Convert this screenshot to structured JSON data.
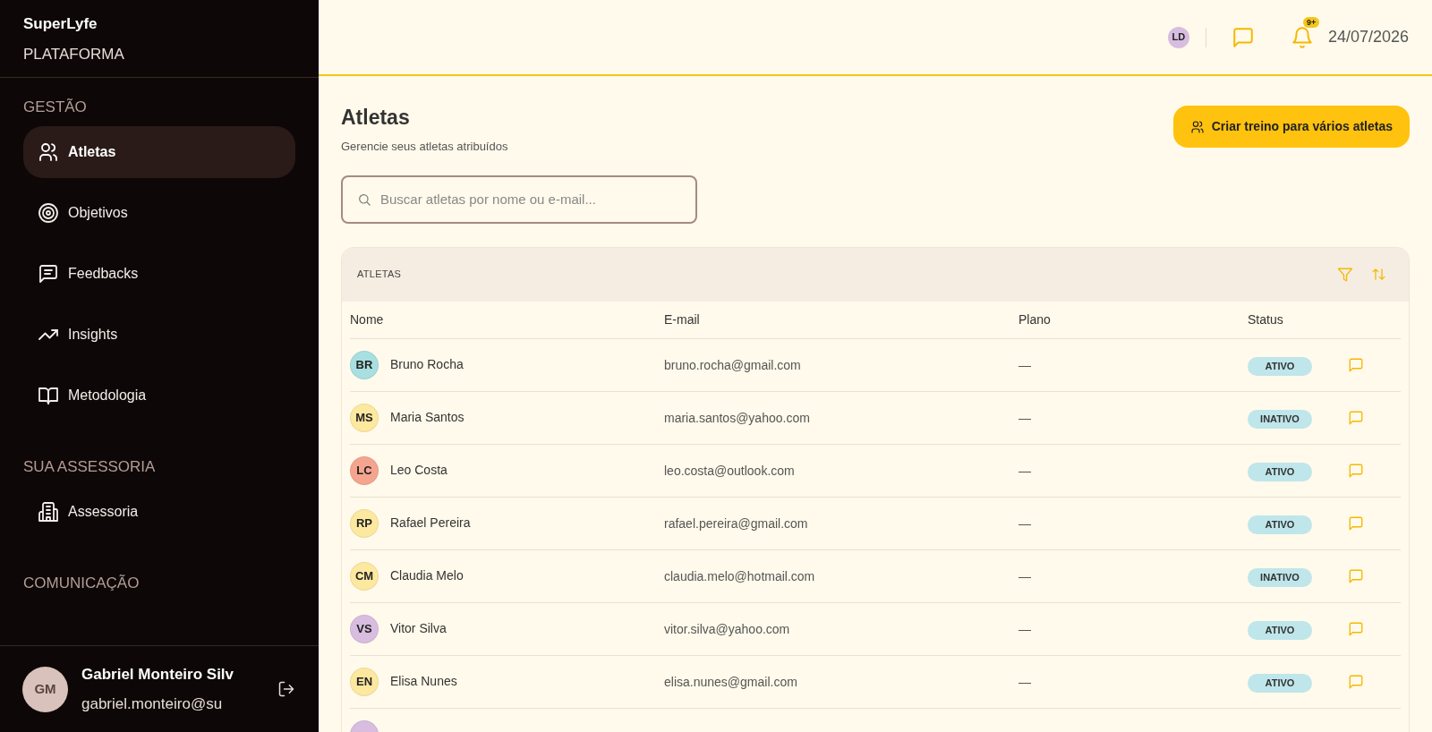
{
  "sidebar": {
    "brand": "SuperLyfe",
    "subtitle": "PLATAFORMA",
    "sections": [
      {
        "title": "GESTÃO",
        "items": [
          {
            "label": "Atletas",
            "kind": "users",
            "selected": true
          },
          {
            "label": "Objetivos",
            "kind": "target",
            "selected": false
          },
          {
            "label": "Feedbacks",
            "kind": "feedback",
            "selected": false
          },
          {
            "label": "Insights",
            "kind": "trend",
            "selected": false
          },
          {
            "label": "Metodologia",
            "kind": "book",
            "selected": false
          }
        ]
      },
      {
        "title": "SUA ASSESSORIA",
        "items": [
          {
            "label": "Assessoria",
            "kind": "building",
            "selected": false
          }
        ]
      },
      {
        "title": "COMUNICAÇÃO"
      }
    ],
    "user": {
      "initials": "GM",
      "name": "Gabriel Monteiro Silv",
      "email": "gabriel.monteiro@su"
    }
  },
  "header": {
    "avatar": "LD",
    "notifications": "9+",
    "date": "24/07/2026"
  },
  "page": {
    "title": "Atletas",
    "subtitle": "Gerencie seus atletas atribuídos",
    "action": "Criar treino para vários atletas",
    "search": {
      "placeholder": "Buscar atletas por nome ou e-mail..."
    }
  },
  "table": {
    "title": "ATLETAS",
    "columns": [
      "Nome",
      "E-mail",
      "Plano",
      "Status"
    ],
    "rows": [
      {
        "initials": "BR",
        "color": "#a8dfe0",
        "name": "Bruno Rocha",
        "email": "bruno.rocha@gmail.com",
        "plan": "—",
        "status": "ATIVO"
      },
      {
        "initials": "MS",
        "color": "#fde8a0",
        "name": "Maria Santos",
        "email": "maria.santos@yahoo.com",
        "plan": "—",
        "status": "INATIVO"
      },
      {
        "initials": "LC",
        "color": "#f5a58f",
        "name": "Leo Costa",
        "email": "leo.costa@outlook.com",
        "plan": "—",
        "status": "ATIVO"
      },
      {
        "initials": "RP",
        "color": "#fde8a0",
        "name": "Rafael Pereira",
        "email": "rafael.pereira@gmail.com",
        "plan": "—",
        "status": "ATIVO"
      },
      {
        "initials": "CM",
        "color": "#fde8a0",
        "name": "Claudia Melo",
        "email": "claudia.melo@hotmail.com",
        "plan": "—",
        "status": "INATIVO"
      },
      {
        "initials": "VS",
        "color": "#d8bde0",
        "name": "Vitor Silva",
        "email": "vitor.silva@yahoo.com",
        "plan": "—",
        "status": "ATIVO"
      },
      {
        "initials": "EN",
        "color": "#fde8a0",
        "name": "Elisa Nunes",
        "email": "elisa.nunes@gmail.com",
        "plan": "—",
        "status": "ATIVO"
      },
      {
        "kind": "partial",
        "color": "#d8bde0"
      }
    ]
  }
}
